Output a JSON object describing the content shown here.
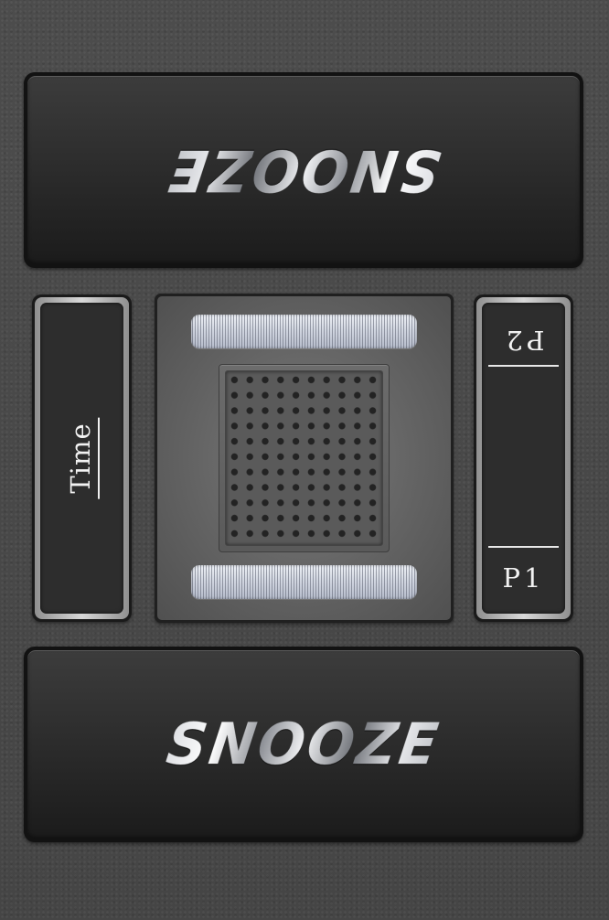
{
  "top_button": {
    "label": "SNOOZE",
    "orientation": "upside-down"
  },
  "bottom_button": {
    "label": "SNOOZE"
  },
  "left_panel": {
    "label": "Time"
  },
  "right_panel": {
    "top_label": "P2",
    "top_orientation": "upside-down",
    "bottom_label": "P1"
  },
  "colors": {
    "background": "#4a4a4a",
    "button_face": "#2a2a2a",
    "panel_screen": "#2d2d2d",
    "panel_frame": "#c0c0c0",
    "grille": "#cfd4df",
    "label_text": "#f2f2f2"
  },
  "icons": {
    "speaker": "speaker-grille-icon"
  }
}
